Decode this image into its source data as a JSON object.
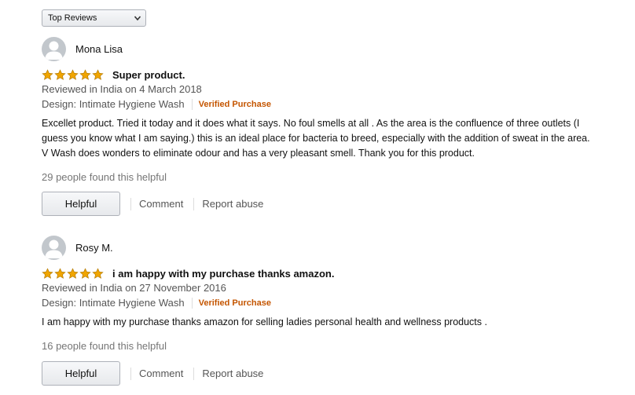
{
  "sort": {
    "label": "Top Reviews",
    "icon": "chevron-down-icon"
  },
  "actions": {
    "helpful": "Helpful",
    "comment": "Comment",
    "report": "Report abuse"
  },
  "colors": {
    "star": "#f0a500",
    "verified": "#c45500",
    "muted": "#555555",
    "count": "#767676"
  },
  "reviews": [
    {
      "name": "Mona Lisa",
      "rating": 5,
      "title": "Super product.",
      "date": "Reviewed in India on 4 March 2018",
      "design": "Design: Intimate Hygiene Wash",
      "verified": "Verified Purchase",
      "body": "Excellet product. Tried it today and it does what it says. No foul smells at all . As the area is the confluence of three outlets (I guess you know what I am saying.) this is an ideal place for bacteria to breed, especially with the addition of sweat in the area. V Wash does wonders to eliminate odour and has a very pleasant smell. Thank you for this product.",
      "helpful_count": "29 people found this helpful"
    },
    {
      "name": "Rosy M.",
      "rating": 5,
      "title": "i am happy with my purchase thanks amazon.",
      "date": "Reviewed in India on 27 November 2016",
      "design": "Design: Intimate Hygiene Wash",
      "verified": "Verified Purchase",
      "body": "I am happy with my purchase thanks amazon for selling ladies personal health and wellness products .",
      "helpful_count": "16 people found this helpful"
    }
  ]
}
